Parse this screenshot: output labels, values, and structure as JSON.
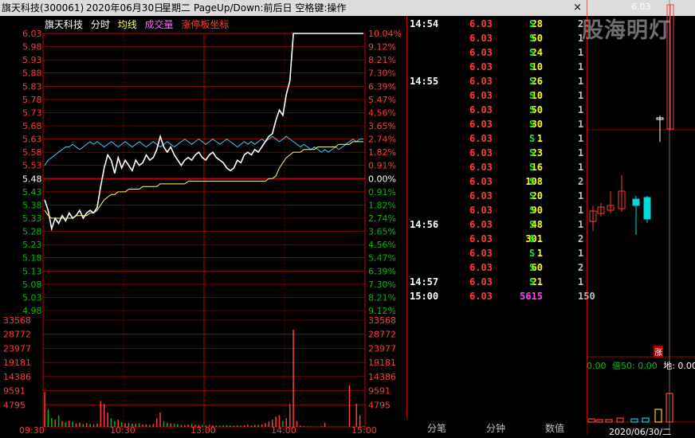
{
  "titlebar": {
    "stock": "旗天科技(300061)",
    "date": "2020年06月30日",
    "weekday": "星期二",
    "hint": "PageUp/Down:前后日 空格键:操作",
    "close": "×"
  },
  "chart_header": {
    "name": "旗天科技",
    "mode": "分时",
    "avg": "均线",
    "vol": "成交量",
    "limit": "涨停板坐标"
  },
  "colors": {
    "price_line": "#ffffff",
    "avg_line": "#ffff66",
    "index_line": "#40c8ff",
    "grid": "#c00000",
    "up": "#ff3c3c",
    "down": "#00d8d8",
    "volume_up": "#ff3c3c",
    "volume_down": "#00c000"
  },
  "chart_data": {
    "type": "line",
    "price_ticks": [
      "6.03",
      "5.98",
      "5.93",
      "5.88",
      "5.83",
      "5.78",
      "5.73",
      "5.68",
      "5.63",
      "5.58",
      "5.53",
      "5.48",
      "5.43",
      "5.38",
      "5.33",
      "5.28",
      "5.23",
      "5.18",
      "5.13",
      "5.08",
      "5.03",
      "4.98"
    ],
    "pct_ticks": [
      "10.04%",
      "9.12%",
      "8.21%",
      "7.30%",
      "6.39%",
      "5.47%",
      "4.56%",
      "3.65%",
      "2.74%",
      "1.82%",
      "0.91%",
      "0.00%",
      "0.91%",
      "1.82%",
      "2.74%",
      "3.65%",
      "4.56%",
      "5.47%",
      "6.39%",
      "7.30%",
      "8.21%",
      "9.12%"
    ],
    "volume_ticks": [
      "33568",
      "28772",
      "23977",
      "19181",
      "14386",
      "9591",
      "4795"
    ],
    "time_ticks": [
      "09:30",
      "10:30",
      "13:00",
      "14:00",
      "15:00"
    ],
    "ylim": [
      4.93,
      6.03
    ],
    "prev_close": 5.48,
    "volume_max": 38000,
    "series": [],
    "price": [
      5.4,
      5.36,
      5.29,
      5.33,
      5.31,
      5.34,
      5.32,
      5.35,
      5.33,
      5.34,
      5.36,
      5.33,
      5.35,
      5.36,
      5.35,
      5.37,
      5.45,
      5.52,
      5.57,
      5.55,
      5.5,
      5.56,
      5.52,
      5.55,
      5.53,
      5.51,
      5.55,
      5.53,
      5.54,
      5.57,
      5.55,
      5.56,
      5.59,
      5.64,
      5.6,
      5.58,
      5.6,
      5.57,
      5.55,
      5.53,
      5.55,
      5.56,
      5.55,
      5.57,
      5.58,
      5.56,
      5.55,
      5.57,
      5.58,
      5.56,
      5.55,
      5.54,
      5.52,
      5.51,
      5.52,
      5.55,
      5.54,
      5.57,
      5.58,
      5.57,
      5.59,
      5.58,
      5.6,
      5.62,
      5.64,
      5.65,
      5.7,
      5.74,
      5.72,
      5.8,
      5.85,
      6.03,
      6.03,
      6.03,
      6.03,
      6.03,
      6.03,
      6.03,
      6.03,
      6.03,
      6.03,
      6.03,
      6.03,
      6.03,
      6.03,
      6.03,
      6.03,
      6.03,
      6.03,
      6.03,
      6.03,
      6.03
    ],
    "avg": [
      5.36,
      5.34,
      5.33,
      5.33,
      5.33,
      5.33,
      5.33,
      5.33,
      5.33,
      5.34,
      5.34,
      5.34,
      5.34,
      5.35,
      5.35,
      5.36,
      5.38,
      5.4,
      5.41,
      5.42,
      5.42,
      5.43,
      5.43,
      5.43,
      5.44,
      5.44,
      5.44,
      5.44,
      5.45,
      5.45,
      5.45,
      5.45,
      5.45,
      5.46,
      5.46,
      5.46,
      5.46,
      5.46,
      5.46,
      5.46,
      5.46,
      5.47,
      5.47,
      5.47,
      5.47,
      5.47,
      5.47,
      5.47,
      5.47,
      5.47,
      5.47,
      5.47,
      5.47,
      5.47,
      5.47,
      5.47,
      5.47,
      5.47,
      5.47,
      5.47,
      5.47,
      5.47,
      5.47,
      5.47,
      5.48,
      5.48,
      5.49,
      5.52,
      5.54,
      5.56,
      5.57,
      5.58,
      5.58,
      5.58,
      5.59,
      5.59,
      5.59,
      5.59,
      5.6,
      5.6,
      5.6,
      5.6,
      5.6,
      5.6,
      5.61,
      5.61,
      5.61,
      5.61,
      5.62,
      5.62,
      5.62,
      5.62
    ],
    "index": [
      5.53,
      5.55,
      5.56,
      5.57,
      5.58,
      5.59,
      5.6,
      5.6,
      5.61,
      5.6,
      5.59,
      5.6,
      5.61,
      5.62,
      5.61,
      5.62,
      5.61,
      5.6,
      5.61,
      5.62,
      5.61,
      5.6,
      5.61,
      5.62,
      5.61,
      5.6,
      5.61,
      5.62,
      5.61,
      5.6,
      5.61,
      5.62,
      5.61,
      5.6,
      5.61,
      5.62,
      5.61,
      5.6,
      5.61,
      5.62,
      5.63,
      5.62,
      5.61,
      5.62,
      5.63,
      5.62,
      5.61,
      5.62,
      5.63,
      5.62,
      5.61,
      5.62,
      5.63,
      5.62,
      5.61,
      5.6,
      5.61,
      5.62,
      5.61,
      5.62,
      5.61,
      5.62,
      5.63,
      5.62,
      5.63,
      5.64,
      5.63,
      5.62,
      5.63,
      5.64,
      5.63,
      5.62,
      5.61,
      5.6,
      5.61,
      5.6,
      5.59,
      5.6,
      5.59,
      5.58,
      5.59,
      5.58,
      5.59,
      5.6,
      5.59,
      5.6,
      5.61,
      5.62,
      5.63,
      5.62,
      5.63,
      5.63
    ],
    "volume": [
      12000,
      6000,
      3000,
      2500,
      4000,
      2000,
      1500,
      2000,
      1800,
      1200,
      1500,
      1000,
      1300,
      1000,
      900,
      1200,
      9000,
      8000,
      5000,
      3000,
      2000,
      2500,
      1500,
      1200,
      1300,
      1100,
      1000,
      1200,
      800,
      900,
      800,
      1000,
      3000,
      5000,
      2000,
      1500,
      1200,
      1000,
      900,
      800,
      700,
      800,
      1000,
      800,
      700,
      600,
      500,
      700,
      600,
      500,
      400,
      500,
      600,
      500,
      400,
      500,
      400,
      600,
      800,
      500,
      700,
      800,
      900,
      1200,
      1800,
      2500,
      3500,
      4000,
      2000,
      3000,
      8000,
      33568,
      2000,
      500,
      300,
      200,
      150,
      100,
      100,
      200,
      1500,
      100,
      100,
      50,
      50,
      100,
      100,
      14386,
      100,
      8000,
      4000,
      300
    ],
    "volume_up": [
      true,
      false,
      false,
      true,
      false,
      true,
      false,
      true,
      false,
      true,
      true,
      false,
      true,
      false,
      false,
      true,
      true,
      true,
      true,
      false,
      false,
      true,
      false,
      true,
      false,
      false,
      true,
      false,
      true,
      true,
      false,
      true,
      true,
      true,
      false,
      false,
      true,
      false,
      false,
      false,
      true,
      true,
      false,
      true,
      true,
      false,
      false,
      true,
      true,
      false,
      false,
      false,
      false,
      false,
      true,
      true,
      false,
      true,
      true,
      false,
      true,
      false,
      true,
      true,
      true,
      true,
      true,
      true,
      false,
      true,
      true,
      true,
      true,
      true,
      true,
      true,
      true,
      true,
      true,
      true,
      true,
      true,
      true,
      true,
      true,
      true,
      true,
      true,
      true,
      true,
      true,
      true
    ]
  },
  "trades": [
    {
      "time": "14:54",
      "price": "6.03",
      "vol": "28",
      "side": "S",
      "n": "2"
    },
    {
      "time": "",
      "price": "6.03",
      "vol": "50",
      "side": "S",
      "n": "1"
    },
    {
      "time": "",
      "price": "6.03",
      "vol": "24",
      "side": "S",
      "n": "1"
    },
    {
      "time": "",
      "price": "6.03",
      "vol": "10",
      "side": "S",
      "n": "1"
    },
    {
      "time": "14:55",
      "price": "6.03",
      "vol": "26",
      "side": "S",
      "n": "1"
    },
    {
      "time": "",
      "price": "6.03",
      "vol": "10",
      "side": "S",
      "n": "1"
    },
    {
      "time": "",
      "price": "6.03",
      "vol": "50",
      "side": "S",
      "n": "1"
    },
    {
      "time": "",
      "price": "6.03",
      "vol": "30",
      "side": "S",
      "n": "1"
    },
    {
      "time": "",
      "price": "6.03",
      "vol": "1",
      "side": "S",
      "n": "1"
    },
    {
      "time": "",
      "price": "6.03",
      "vol": "23",
      "side": "S",
      "n": "1"
    },
    {
      "time": "",
      "price": "6.03",
      "vol": "16",
      "side": "S",
      "n": "1"
    },
    {
      "time": "",
      "price": "6.03",
      "vol": "108",
      "side": "S",
      "n": "2"
    },
    {
      "time": "",
      "price": "6.03",
      "vol": "20",
      "side": "S",
      "n": "1"
    },
    {
      "time": "",
      "price": "6.03",
      "vol": "90",
      "side": "S",
      "n": "1"
    },
    {
      "time": "14:56",
      "price": "6.03",
      "vol": "48",
      "side": "S",
      "n": "1"
    },
    {
      "time": "",
      "price": "6.03",
      "vol": "301",
      "side": "S",
      "n": "2"
    },
    {
      "time": "",
      "price": "6.03",
      "vol": "1",
      "side": "S",
      "n": "1"
    },
    {
      "time": "",
      "price": "6.03",
      "vol": "60",
      "side": "S",
      "n": "2"
    },
    {
      "time": "14:57",
      "price": "6.03",
      "vol": "21",
      "side": "S",
      "n": "1"
    },
    {
      "time": "15:00",
      "price": "6.03",
      "vol": "5615",
      "side": "",
      "n": "150"
    }
  ],
  "bottom_tabs": [
    "分笔",
    "分钟",
    "数值"
  ],
  "right": {
    "watermark": "股海明灯",
    "top_price": "6.03",
    "limit_badge": "涨",
    "ind_a": "0.00",
    "ind_b": "倍50: 0.00",
    "ind_c": "地: 0.00",
    "date": "2020/06/30/二"
  }
}
